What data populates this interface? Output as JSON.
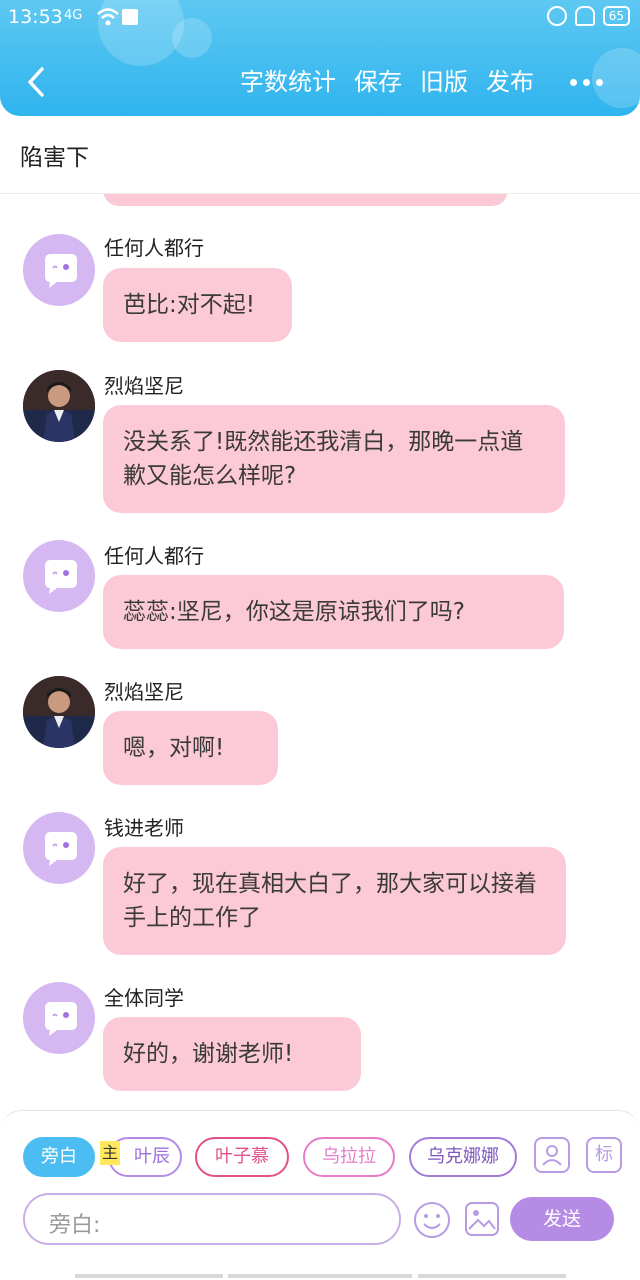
{
  "status_bar": {
    "time": "13:53",
    "signal": "4G",
    "wifi_label": "HD",
    "battery": "65"
  },
  "toolbar": {
    "word_count": "字数统计",
    "save": "保存",
    "old_version": "旧版",
    "publish": "发布"
  },
  "title": "陷害下",
  "messages": [
    {
      "sender": "任何人都行",
      "avatar": "default",
      "text": "芭比:对不起!"
    },
    {
      "sender": "烈焰坚尼",
      "avatar": "photo",
      "text": "没关系了!既然能还我清白，那晚一点道歉又能怎么样呢?"
    },
    {
      "sender": "任何人都行",
      "avatar": "default",
      "text": "蕊蕊:坚尼，你这是原谅我们了吗?"
    },
    {
      "sender": "烈焰坚尼",
      "avatar": "photo",
      "text": "嗯，对啊!"
    },
    {
      "sender": "钱进老师",
      "avatar": "default",
      "text": "好了，现在真相大白了，那大家可以接着手上的工作了"
    },
    {
      "sender": "全体同学",
      "avatar": "default",
      "text": "好的，谢谢老师!"
    }
  ],
  "roles": {
    "narrator": "旁白",
    "main_tag": "主",
    "ye_chen": "叶辰",
    "ye_zimu": "叶子慕",
    "wu_lala": "乌拉拉",
    "wukenana": "乌克娜娜",
    "tag_button": "标"
  },
  "composer": {
    "placeholder": "旁白:",
    "send": "发送"
  },
  "colors": {
    "header": "#2fb4ee",
    "bubble": "#fcc9d6",
    "accent_purple": "#b58be6"
  }
}
